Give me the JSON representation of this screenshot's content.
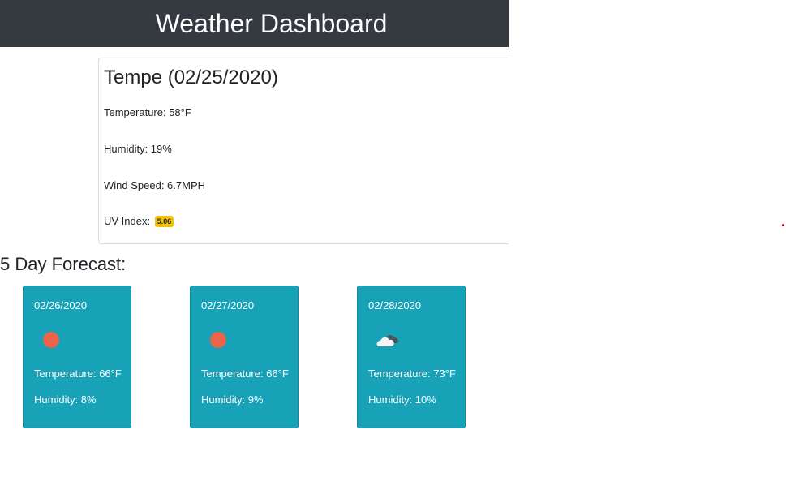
{
  "header": {
    "title": "Weather Dashboard"
  },
  "current": {
    "city_date": "Tempe (02/25/2020)",
    "temperature": "Temperature: 58°F",
    "humidity": "Humidity: 19%",
    "wind": "Wind Speed: 6.7MPH",
    "uv_label": "UV Index:",
    "uv_value": "5.06",
    "uv_color": "#f5c400"
  },
  "forecast": {
    "title": "5 Day Forecast:",
    "card_color": "#17a2b8",
    "days": [
      {
        "date": "02/26/2020",
        "icon": "clear-sun-icon",
        "temperature": "Temperature: 66°F",
        "humidity": "Humidity: 8%"
      },
      {
        "date": "02/27/2020",
        "icon": "clear-sun-icon",
        "temperature": "Temperature: 66°F",
        "humidity": "Humidity: 9%"
      },
      {
        "date": "02/28/2020",
        "icon": "cloudy-icon",
        "temperature": "Temperature: 73°F",
        "humidity": "Humidity: 10%"
      }
    ]
  }
}
